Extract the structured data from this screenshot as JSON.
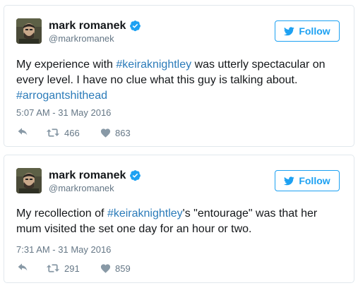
{
  "colors": {
    "accent": "#1da1f2",
    "hashtag": "#2b7bb9",
    "secondary_text": "#657786",
    "verified": "#1da1f2",
    "border": "#e1e8ed"
  },
  "icons": {
    "follow": "twitter-bird-icon",
    "verified": "verified-badge-icon",
    "reply": "reply-icon",
    "retweet": "retweet-icon",
    "like": "heart-icon"
  },
  "tweets": [
    {
      "author": {
        "name": "mark romanek",
        "handle": "@markromanek"
      },
      "follow_label": "Follow",
      "text": {
        "part1": "My experience with ",
        "hashtag1": "#keiraknightley",
        "part2": " was utterly spectacular on every level. I have no clue what this guy is talking about. ",
        "hashtag2": "#arrogantshithead"
      },
      "timestamp": "5:07 AM - 31 May 2016",
      "retweets": "466",
      "likes": "863"
    },
    {
      "author": {
        "name": "mark romanek",
        "handle": "@markromanek"
      },
      "follow_label": "Follow",
      "text": {
        "part1": "My recollection of ",
        "hashtag1": "#keiraknightley",
        "part2": "'s \"entourage\" was that her mum visited the set one day for an hour or two."
      },
      "timestamp": "7:31 AM - 31 May 2016",
      "retweets": "291",
      "likes": "859"
    }
  ]
}
